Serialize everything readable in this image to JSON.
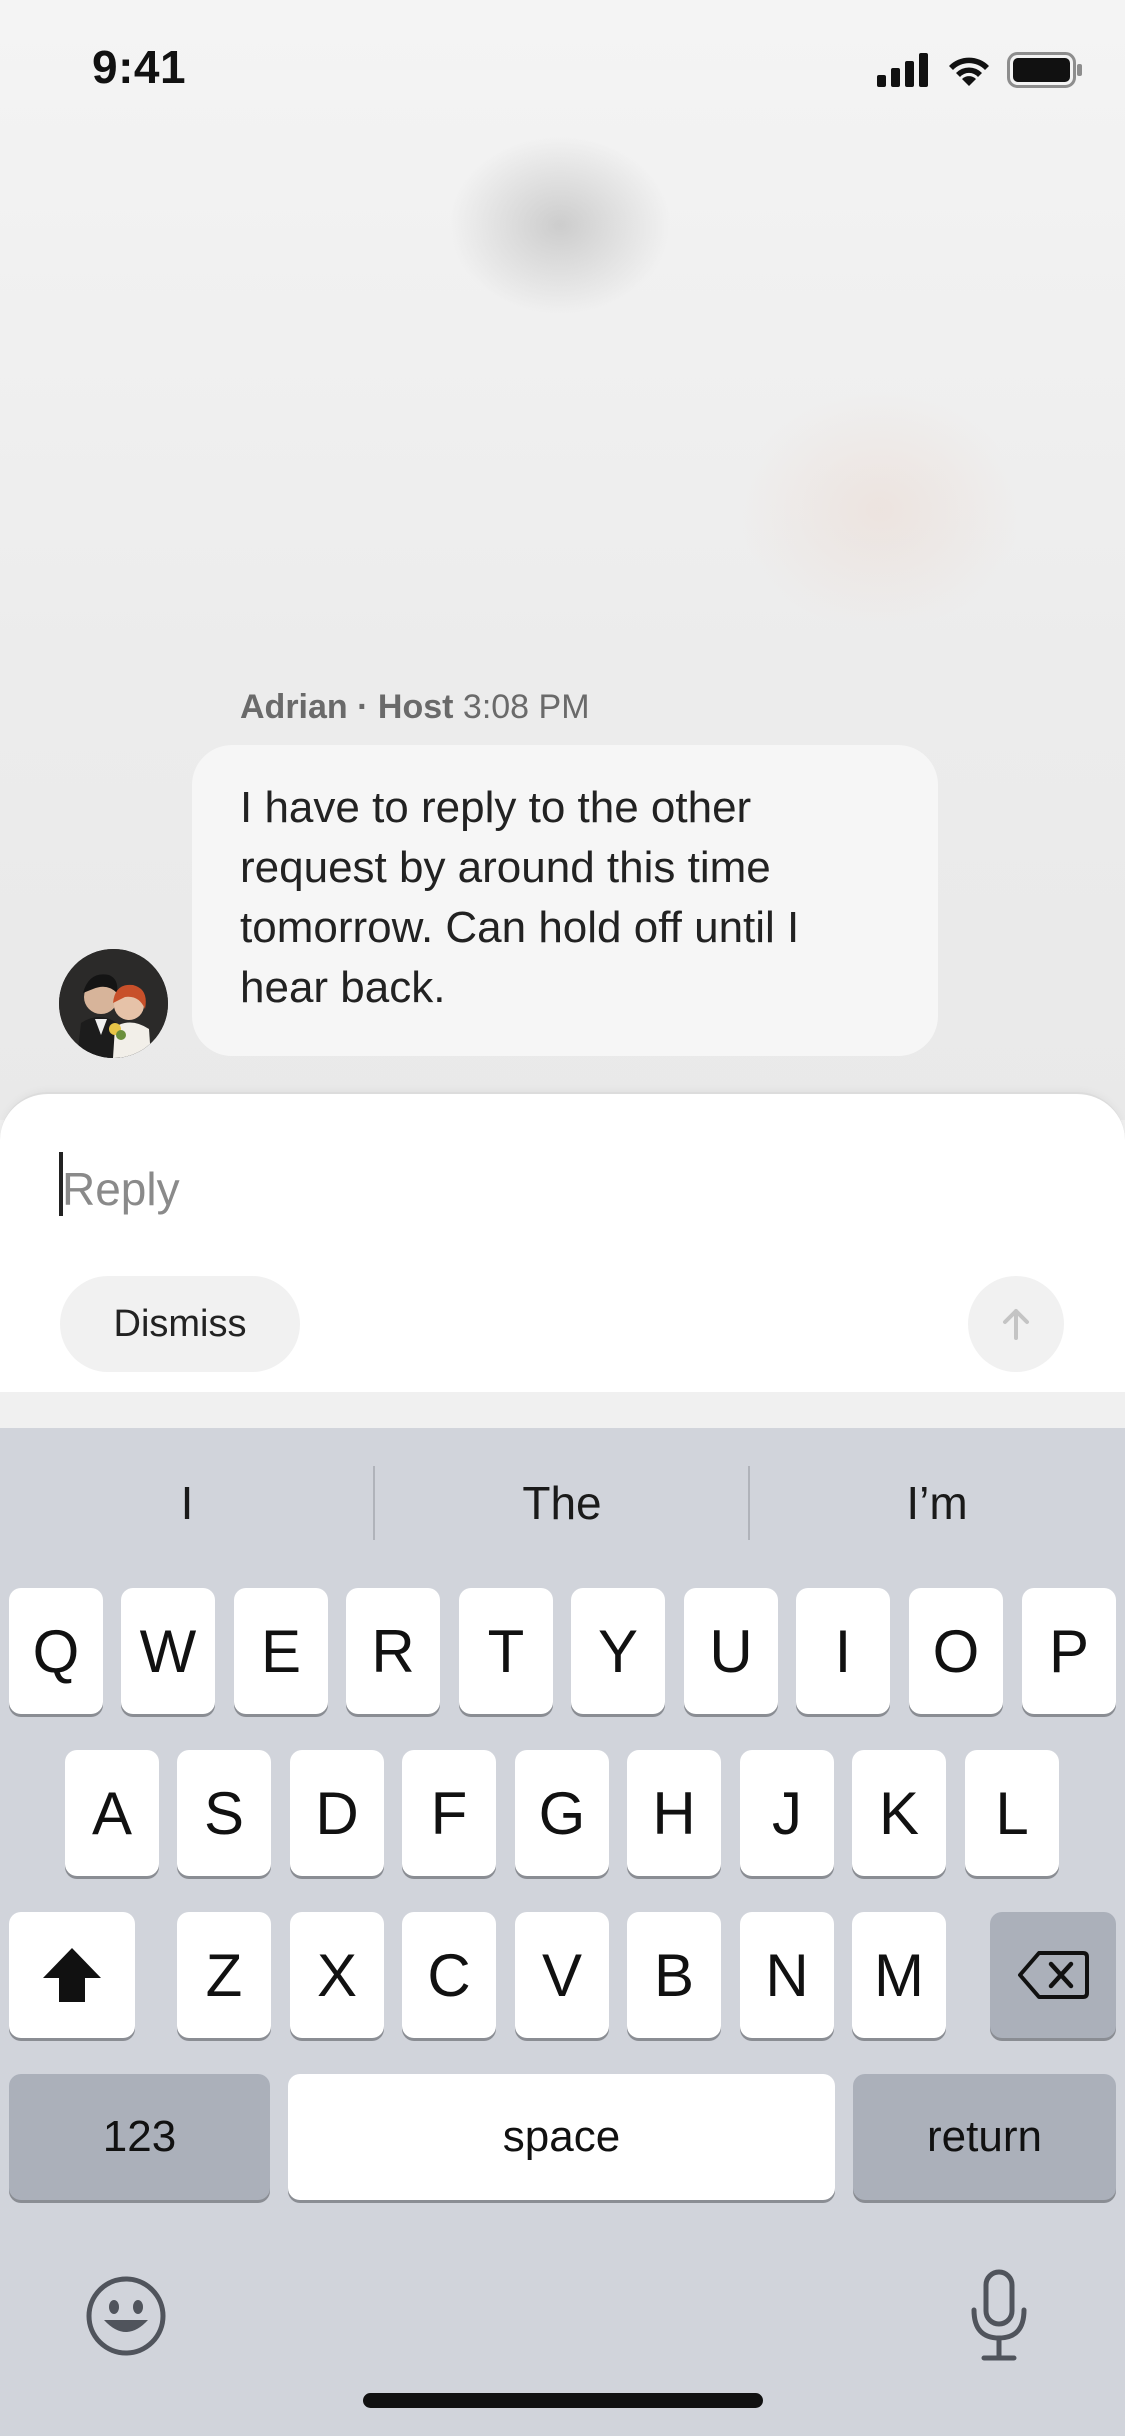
{
  "status_bar": {
    "time": "9:41",
    "icons": [
      "cellular-signal-icon",
      "wifi-icon",
      "battery-icon"
    ]
  },
  "message": {
    "sender": "Adrian",
    "separator": " · ",
    "role": "Host",
    "time": "3:08 PM",
    "text": "I have to reply to the other request by around this time tomorrow. Can hold off until I hear back."
  },
  "composer": {
    "placeholder": "Reply",
    "value": "",
    "dismiss_label": "Dismiss",
    "send_icon": "arrow-up-icon"
  },
  "keyboard": {
    "suggestions": [
      "I",
      "The",
      "I’m"
    ],
    "row1": [
      "Q",
      "W",
      "E",
      "R",
      "T",
      "Y",
      "U",
      "I",
      "O",
      "P"
    ],
    "row2": [
      "A",
      "S",
      "D",
      "F",
      "G",
      "H",
      "J",
      "K",
      "L"
    ],
    "row3": [
      "Z",
      "X",
      "C",
      "V",
      "B",
      "N",
      "M"
    ],
    "numbers_label": "123",
    "space_label": "space",
    "return_label": "return",
    "shift_icon": "shift-icon",
    "delete_icon": "backspace-icon",
    "emoji_icon": "emoji-icon",
    "mic_icon": "microphone-icon"
  },
  "colors": {
    "keyboard_bg": "#d1d4db",
    "key": "#ffffff",
    "key_dark": "#abb0ba",
    "bubble": "#f6f6f6"
  }
}
